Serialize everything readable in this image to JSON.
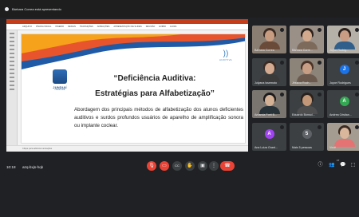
{
  "presenter_bar": {
    "text": "Bárbara Correa está apresentando"
  },
  "ppt": {
    "tabs": [
      "Arquivo",
      "Página Inicial",
      "Inserir",
      "Design",
      "Transições",
      "Animações",
      "Apresentação de Slides",
      "Revisão",
      "Exibir",
      "Ajuda"
    ],
    "status": "Clique para adicionar anotações"
  },
  "slide": {
    "logo_name": "JUNDIAÍ",
    "logo_sub": "PREFEITURA",
    "brand_symbol": "))",
    "brand_name": "AUDITIVA",
    "title_line1": "“Deficiência Auditiva:",
    "title_line2": "Estratégias para Alfabetização”",
    "body": "Abordagem dos principais métodos de alfabetização dos alunos deficientes auditivos e surdos profundos usuários de aparelho de amplificação sonora ou implante coclear."
  },
  "participants": [
    {
      "name": "Bárbara Correa",
      "type": "photo",
      "skin": "#c79c80",
      "hair": "#3a2a22",
      "shirt": "#6a4b3a",
      "bg": "#8a7e72"
    },
    {
      "name": "Bárbara Corre...",
      "type": "photo",
      "skin": "#d2a98c",
      "hair": "#2b211c",
      "shirt": "#7d6a5b",
      "bg": "#9a9088"
    },
    {
      "name": "Joyce Rodrig...",
      "type": "photo",
      "skin": "#c99d84",
      "hair": "#2a201c",
      "shirt": "#2f5f8a",
      "bg": "#b5b0a8"
    },
    {
      "name": "Julyana Issemoto",
      "type": "photo",
      "skin": "#d4ab91",
      "hair": "#3a2b22",
      "shirt": "#3a3a3a",
      "bg": "#3c4043"
    },
    {
      "name": "Jéssica Roch...",
      "type": "photo",
      "skin": "#c89e84",
      "hair": "#4a3326",
      "shirt": "#6d5a4e",
      "bg": "#8c8379"
    },
    {
      "name": "Joyce Rodrigues",
      "type": "avatar",
      "initial": "J",
      "color": "#1a73e8"
    },
    {
      "name": "Amanda Forti B...",
      "type": "photo",
      "skin": "#d4b094",
      "hair": "#1c1a1a",
      "shirt": "#263238",
      "bg": "#7a756f"
    },
    {
      "name": "Eduardo Bonsol...",
      "type": "photo",
      "skin": "#c39878",
      "hair": "#2b211c",
      "shirt": "#4e4e4e",
      "bg": "#3c4043"
    },
    {
      "name": "Andrea Cristian...",
      "type": "avatar",
      "initial": "A",
      "color": "#34a853"
    },
    {
      "name": "Ana Luiza Grant...",
      "type": "avatar",
      "initial": "A",
      "color": "#a142f4"
    },
    {
      "name": "Mais 5 pessoas",
      "type": "avatar",
      "initial": "5",
      "color": "#5f6368"
    },
    {
      "name": "Você",
      "type": "photo",
      "skin": "#d9b79c",
      "hair": "#3a2a22",
      "shirt": "#e57373",
      "bg": "#a49c90"
    }
  ],
  "bottom": {
    "time": "10:18",
    "code": "azq-bxjs-hqk",
    "controls": {
      "mic": "🎙",
      "cam": "▭",
      "cc": "CC",
      "hand": "✋",
      "present": "▣",
      "more": "⋮",
      "hangup": "☎"
    },
    "right_icons": {
      "info": "ⓘ",
      "people": "👥",
      "chat": "💬",
      "activities": "⬚"
    },
    "people_count": "17"
  }
}
